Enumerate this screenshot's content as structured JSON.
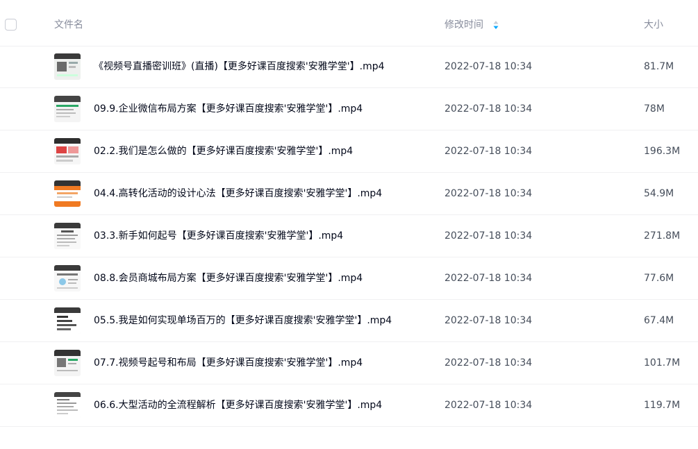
{
  "header": {
    "name_label": "文件名",
    "time_label": "修改时间",
    "size_label": "大小",
    "sort_icon": "sort-icon"
  },
  "files": [
    {
      "name": "《视频号直播密训班》(直播)【更多好课百度搜索'安雅学堂'】.mp4",
      "time": "2022-07-18 10:34",
      "size": "81.7M",
      "icon": "video-thumbnail"
    },
    {
      "name": "09.9.企业微信布局方案【更多好课百度搜索'安雅学堂'】.mp4",
      "time": "2022-07-18 10:34",
      "size": "78M",
      "icon": "video-thumbnail"
    },
    {
      "name": "02.2.我们是怎么做的【更多好课百度搜索'安雅学堂'】.mp4",
      "time": "2022-07-18 10:34",
      "size": "196.3M",
      "icon": "video-thumbnail"
    },
    {
      "name": "04.4.高转化活动的设计心法【更多好课百度搜索'安雅学堂'】.mp4",
      "time": "2022-07-18 10:34",
      "size": "54.9M",
      "icon": "video-thumbnail"
    },
    {
      "name": "03.3.新手如何起号【更多好课百度搜索'安雅学堂'】.mp4",
      "time": "2022-07-18 10:34",
      "size": "271.8M",
      "icon": "video-thumbnail"
    },
    {
      "name": "08.8.会员商城布局方案【更多好课百度搜索'安雅学堂'】.mp4",
      "time": "2022-07-18 10:34",
      "size": "77.6M",
      "icon": "video-thumbnail"
    },
    {
      "name": "05.5.我是如何实现单场百万的【更多好课百度搜索'安雅学堂'】.mp4",
      "time": "2022-07-18 10:34",
      "size": "67.4M",
      "icon": "video-thumbnail"
    },
    {
      "name": "07.7.视频号起号和布局【更多好课百度搜索'安雅学堂'】.mp4",
      "time": "2022-07-18 10:34",
      "size": "101.7M",
      "icon": "video-thumbnail"
    },
    {
      "name": "06.6.大型活动的全流程解析【更多好课百度搜索'安雅学堂'】.mp4",
      "time": "2022-07-18 10:34",
      "size": "119.7M",
      "icon": "video-thumbnail"
    }
  ],
  "colors": {
    "accent": "#06a7ff",
    "divider": "#f0f0f2",
    "header_text": "#878c9c",
    "orange": "#f07a22"
  }
}
